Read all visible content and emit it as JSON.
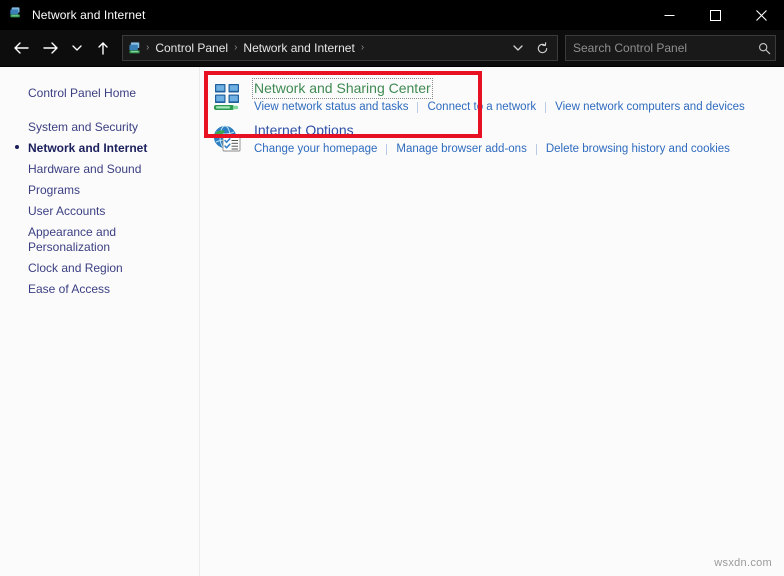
{
  "window": {
    "title": "Network and Internet",
    "title_icon": "network-icon",
    "controls": {
      "minimize": "minimize-icon",
      "maximize": "maximize-icon",
      "close": "close-icon"
    }
  },
  "navbar": {
    "back": "back-arrow-icon",
    "forward": "forward-arrow-icon",
    "recent": "chevron-down-icon",
    "up": "up-arrow-icon",
    "address": {
      "icon": "network-icon",
      "crumbs": [
        "Control Panel",
        "Network and Internet"
      ],
      "separator": "›",
      "dropdown": "chevron-down-icon",
      "refresh": "refresh-icon"
    },
    "search": {
      "placeholder": "Search Control Panel",
      "icon": "search-icon"
    }
  },
  "sidebar": {
    "items": [
      {
        "label": "Control Panel Home",
        "current": false
      },
      {
        "label": "System and Security",
        "current": false
      },
      {
        "label": "Network and Internet",
        "current": true
      },
      {
        "label": "Hardware and Sound",
        "current": false
      },
      {
        "label": "Programs",
        "current": false
      },
      {
        "label": "User Accounts",
        "current": false
      },
      {
        "label": "Appearance and\nPersonalization",
        "current": false
      },
      {
        "label": "Clock and Region",
        "current": false
      },
      {
        "label": "Ease of Access",
        "current": false
      }
    ]
  },
  "content": {
    "categories": [
      {
        "icon": "network-sharing-center-icon",
        "title": "Network and Sharing Center",
        "title_color": "#3f8a52",
        "focused": true,
        "links": [
          "View network status and tasks",
          "Connect to a network",
          "View network computers and devices"
        ]
      },
      {
        "icon": "internet-options-icon",
        "title": "Internet Options",
        "title_color": "#2f4fa8",
        "focused": false,
        "links": [
          "Change your homepage",
          "Manage browser add-ons",
          "Delete browsing history and cookies"
        ]
      }
    ],
    "highlight": {
      "name": "red-highlight-box",
      "color": "#e81123"
    }
  },
  "watermark": "wsxdn.com"
}
